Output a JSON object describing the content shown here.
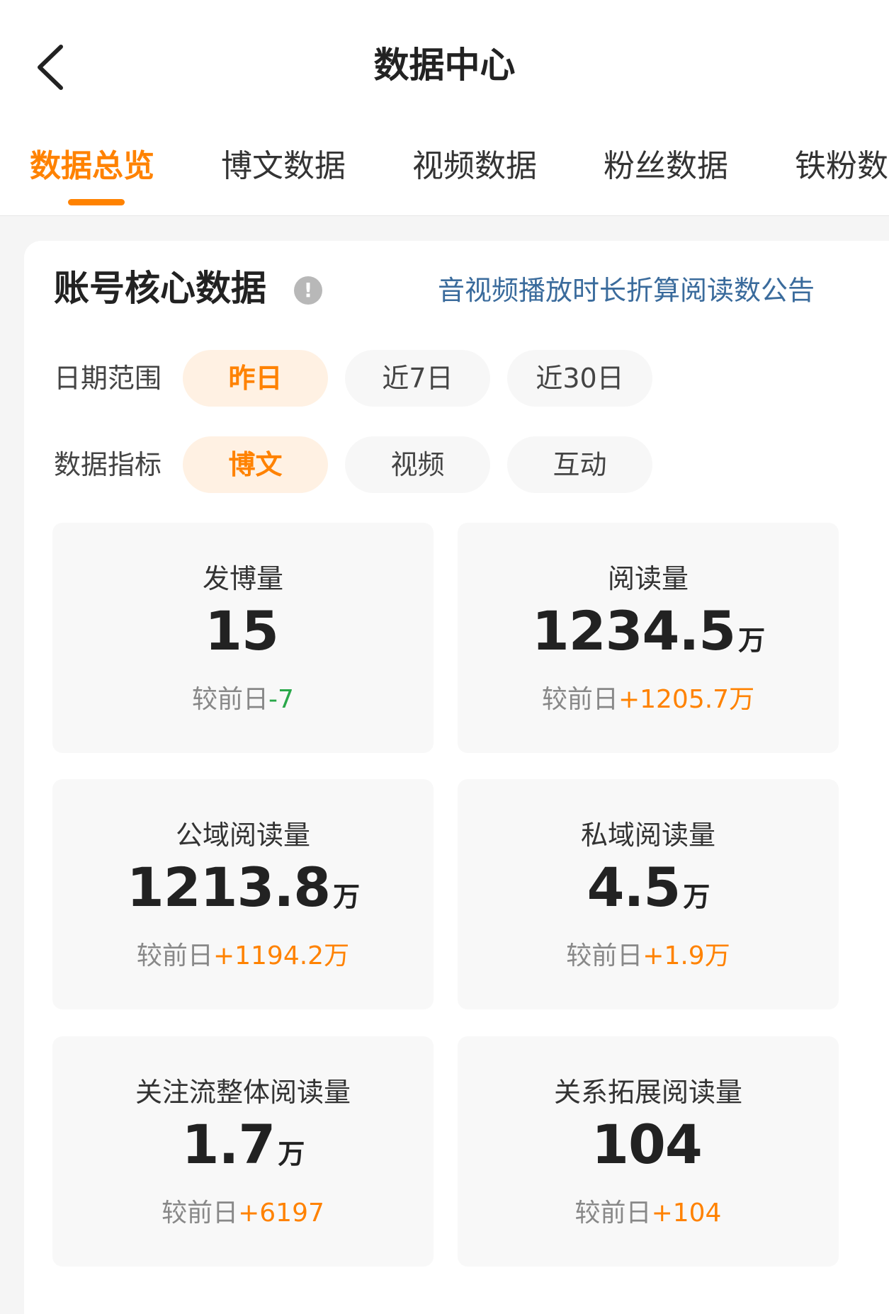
{
  "header": {
    "title": "数据中心",
    "tabs": [
      "数据总览",
      "博文数据",
      "视频数据",
      "粉丝数据",
      "铁粉数"
    ]
  },
  "section": {
    "title": "账号核心数据",
    "info_icon": "!",
    "notice": "音视频播放时长折算阅读数公告"
  },
  "filters": {
    "date_label": "日期范围",
    "date_options": [
      "昨日",
      "近7日",
      "近30日"
    ],
    "metric_label": "数据指标",
    "metric_options": [
      "博文",
      "视频",
      "互动"
    ]
  },
  "stats": [
    {
      "label": "发博量",
      "value": "15",
      "unit": "",
      "compare_label": "较前日",
      "compare_value": "-7",
      "trend": "neg"
    },
    {
      "label": "阅读量",
      "value": "1234.5",
      "unit": "万",
      "compare_label": "较前日",
      "compare_value": "+1205.7万",
      "trend": "pos"
    },
    {
      "label": "公域阅读量",
      "value": "1213.8",
      "unit": "万",
      "compare_label": "较前日",
      "compare_value": "+1194.2万",
      "trend": "pos"
    },
    {
      "label": "私域阅读量",
      "value": "4.5",
      "unit": "万",
      "compare_label": "较前日",
      "compare_value": "+1.9万",
      "trend": "pos"
    },
    {
      "label": "关注流整体阅读量",
      "value": "1.7",
      "unit": "万",
      "compare_label": "较前日",
      "compare_value": "+6197",
      "trend": "pos"
    },
    {
      "label": "关系拓展阅读量",
      "value": "104",
      "unit": "",
      "compare_label": "较前日",
      "compare_value": "+104",
      "trend": "pos"
    }
  ],
  "colors": {
    "accent": "#ff8200",
    "link": "#3a6b9c",
    "negative": "#2aa84a"
  }
}
